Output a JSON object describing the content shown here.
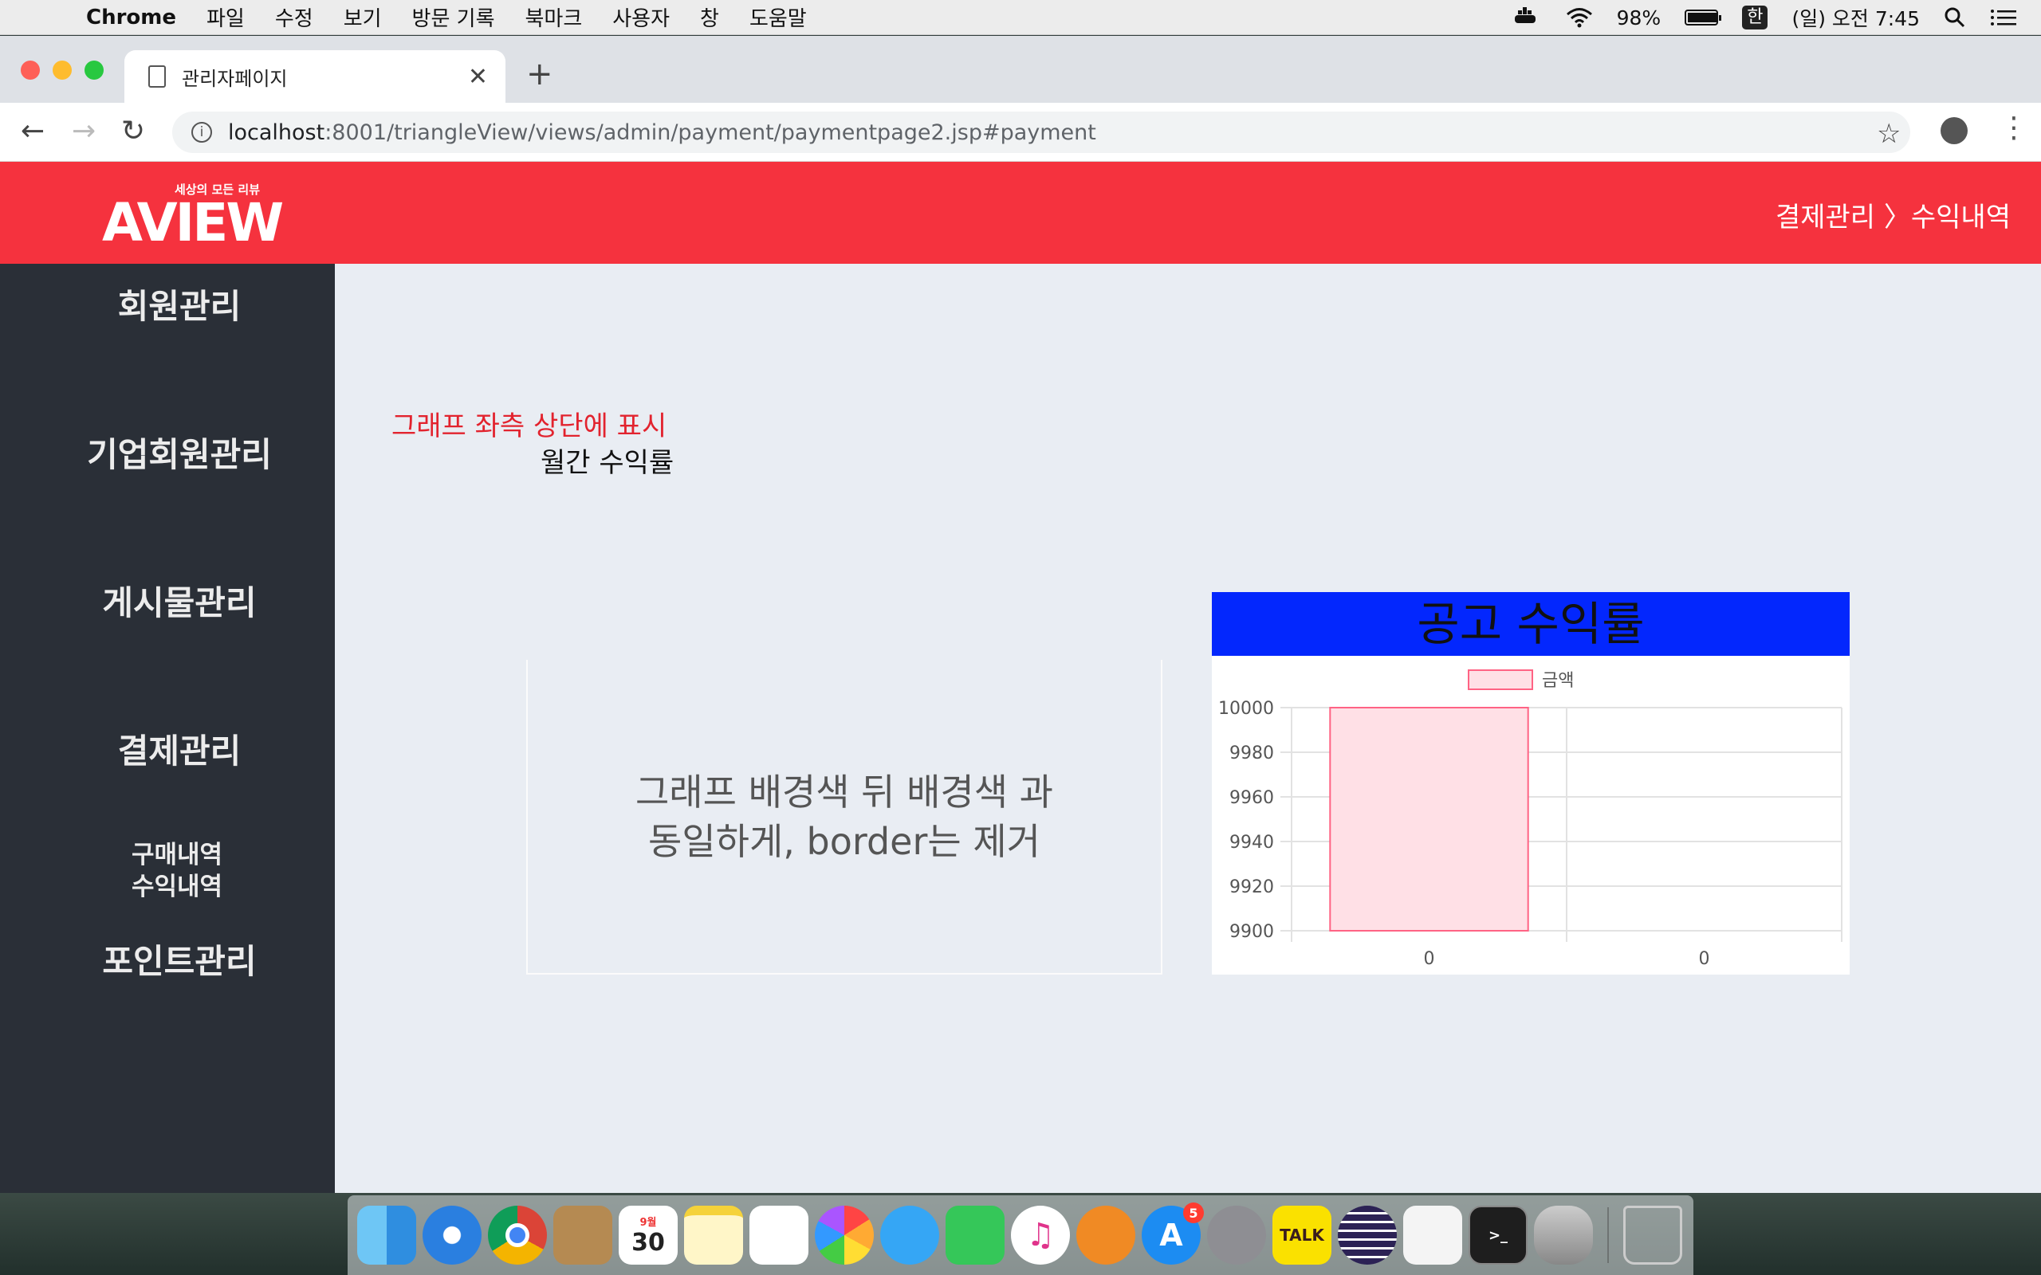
{
  "menubar": {
    "app": "Chrome",
    "items": [
      "파일",
      "수정",
      "보기",
      "방문 기록",
      "북마크",
      "사용자",
      "창",
      "도움말"
    ],
    "battery": "98%",
    "battery_level": 0.98,
    "input_method": "한",
    "clock": "(일) 오전 7:45"
  },
  "browser": {
    "tab_title": "관리자페이지",
    "url_host": "localhost",
    "url_path": ":8001/triangleView/views/admin/payment/paymentpage2.jsp#payment"
  },
  "header": {
    "logo_word": "AVIEW",
    "logo_tagline": "세상의 모든 리뷰",
    "breadcrumb": "결제관리 〉수익내역"
  },
  "sidebar": {
    "items": [
      "회원관리",
      "기업회원관리",
      "게시물관리",
      "결제관리",
      "포인트관리"
    ],
    "sub_items": [
      "구매내역",
      "수익내역"
    ]
  },
  "main": {
    "note": "그래프 좌측 상단에 표시",
    "monthly_label": "월간 수익률",
    "placeholder_text": "그래프 배경색 뒤 배경색 과 동일하게, border는 제거"
  },
  "chart_title": "공고 수익률",
  "chart_data": {
    "type": "bar",
    "categories": [
      "0",
      "0"
    ],
    "series": [
      {
        "name": "금액",
        "values": [
          10000,
          null
        ]
      }
    ],
    "ylim": [
      9900,
      10000
    ],
    "yticks": [
      10000,
      9980,
      9960,
      9940,
      9920,
      9900
    ],
    "legend": "top",
    "grid": true,
    "bar_color": "#ffe0e6",
    "bar_border": "#ff6384"
  },
  "dock": {
    "apps": [
      "finder-icon",
      "safari-icon",
      "chrome-icon",
      "contacts-icon",
      "calendar-icon",
      "notes-icon",
      "reminders-icon",
      "photos-icon",
      "messages-icon",
      "facetime-icon",
      "itunes-icon",
      "books-icon",
      "appstore-icon",
      "system-preferences-icon",
      "kakaotalk-icon",
      "eclipse-icon",
      "textedit-icon",
      "terminal-icon",
      "database-icon"
    ],
    "calendar_month": "9월",
    "calendar_day": "30",
    "appstore_badge": "5",
    "kakaotalk_label": "TALK"
  }
}
